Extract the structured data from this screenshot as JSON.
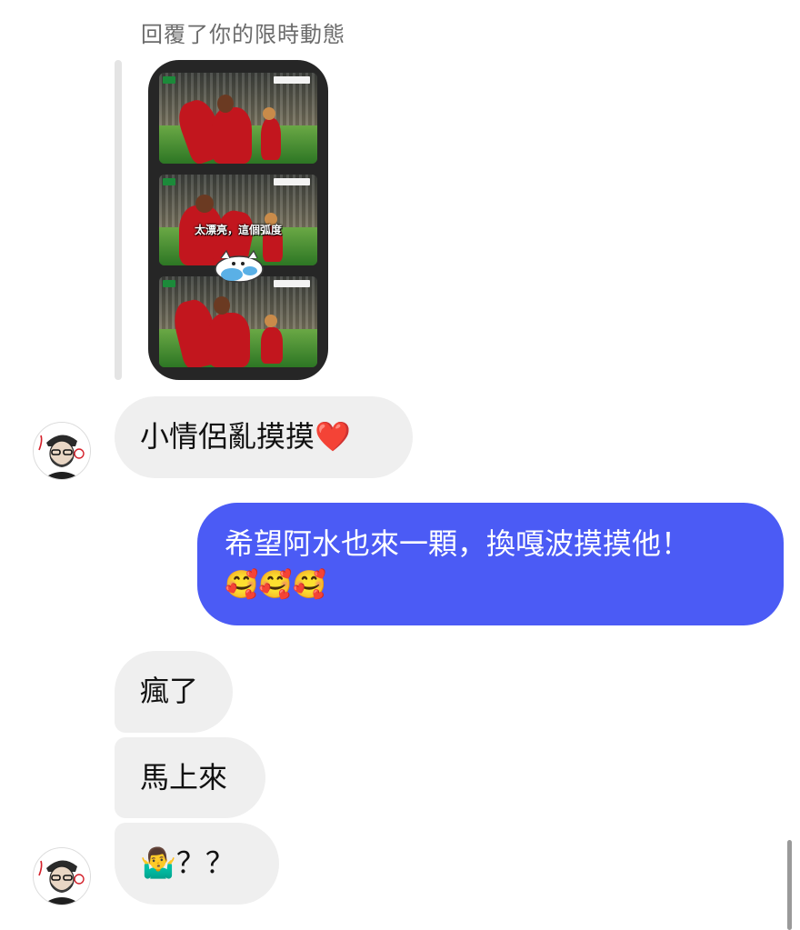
{
  "story_reply": {
    "caption": "回覆了你的限時動態",
    "overlay_text": "太漂亮，這個弧度"
  },
  "messages": [
    {
      "id": "m1",
      "direction": "incoming",
      "text": "小情侶亂摸摸❤️"
    },
    {
      "id": "m2",
      "direction": "outgoing",
      "text": "希望阿水也來一顆，換嘎波摸摸他！",
      "emojis": "🥰🥰🥰"
    },
    {
      "id": "m3",
      "direction": "incoming",
      "text": "瘋了"
    },
    {
      "id": "m4",
      "direction": "incoming",
      "text": "馬上來"
    },
    {
      "id": "m5",
      "direction": "incoming",
      "text": "🤷‍♂️？？"
    }
  ],
  "colors": {
    "outgoing_bubble": "#4b5bf5",
    "incoming_bubble": "#efefef",
    "caption_text": "#6b6b6b"
  }
}
